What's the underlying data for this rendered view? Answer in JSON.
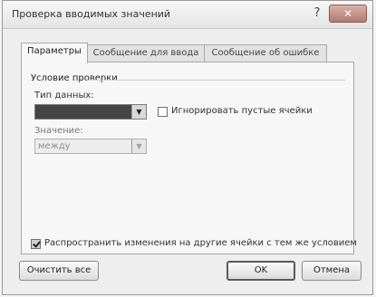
{
  "window": {
    "title": "Проверка вводимых значений",
    "help": "?",
    "close": "✕"
  },
  "tabs": [
    {
      "label": "Параметры",
      "active": true
    },
    {
      "label": "Сообщение для ввода",
      "active": false
    },
    {
      "label": "Сообщение об ошибке",
      "active": false
    }
  ],
  "panel": {
    "group_label": "Условие проверки",
    "data_type_label": "Тип данных:",
    "data_type_value": "",
    "value_label": "Значение:",
    "value_value": "между",
    "ignore_blank_label": "Игнорировать пустые ячейки",
    "ignore_blank_checked": false,
    "apply_all_label": "Распространить изменения на другие ячейки с тем же условием",
    "apply_all_checked": true
  },
  "buttons": {
    "clear_all": "Очистить все",
    "ok": "OK",
    "cancel": "Отмена"
  }
}
